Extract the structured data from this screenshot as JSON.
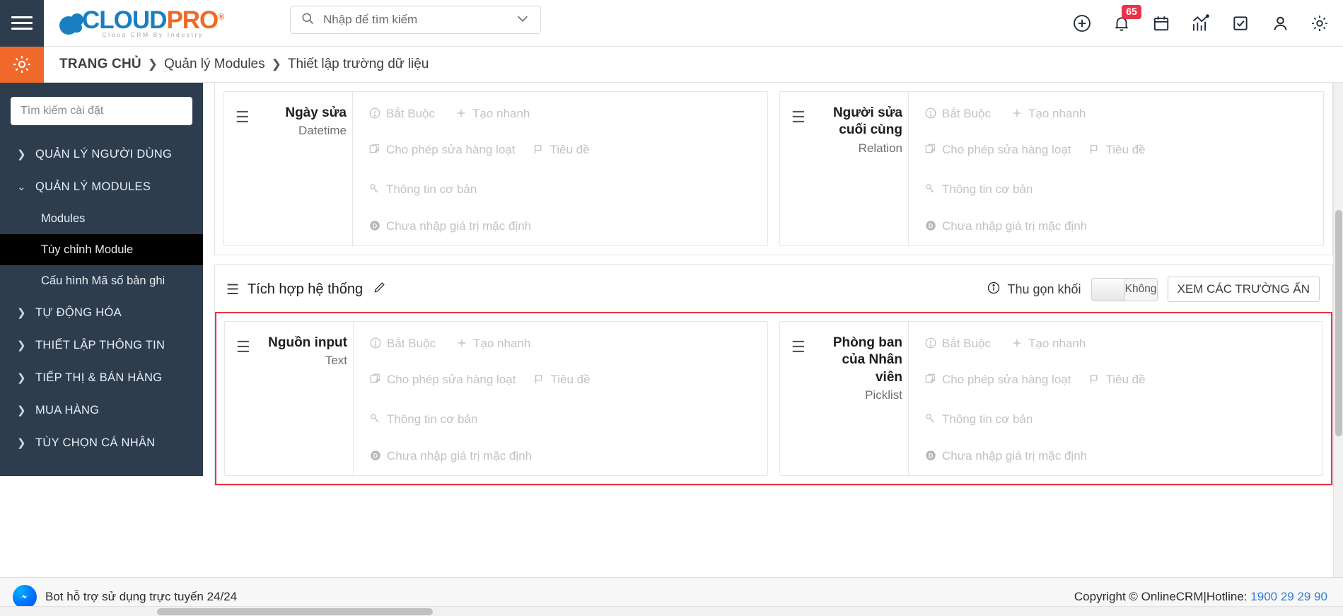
{
  "header": {
    "menu_icon": "hamburger-icon",
    "logo": {
      "cloud": "CLOUD",
      "pro": "PRO",
      "reg": "®",
      "tagline": "Cloud CRM By Industry"
    },
    "search": {
      "placeholder": "Nhập để tìm kiếm",
      "value": "",
      "icon": "search-icon",
      "chevron": "chevron-down-icon"
    },
    "icons": [
      {
        "name": "add-circle-icon",
        "label": ""
      },
      {
        "name": "bell-icon",
        "label": "",
        "badge": "65"
      },
      {
        "name": "calendar-icon",
        "label": ""
      },
      {
        "name": "analytics-icon",
        "label": ""
      },
      {
        "name": "task-check-icon",
        "label": ""
      },
      {
        "name": "user-icon",
        "label": ""
      },
      {
        "name": "settings-gear-icon",
        "label": ""
      }
    ]
  },
  "breadcrumb": {
    "gear_icon": "settings-gear-icon",
    "home": "TRANG CHỦ",
    "sep": "❯",
    "items": [
      "Quản lý Modules",
      "Thiết lập trường dữ liệu"
    ]
  },
  "sidebar": {
    "search_placeholder": "Tìm kiếm cài đặt",
    "items": [
      {
        "label": "QUẢN LÝ NGƯỜI DÙNG",
        "type": "group",
        "expanded": false,
        "arrow": "❯"
      },
      {
        "label": "QUẢN LÝ MODULES",
        "type": "group",
        "expanded": true,
        "arrow": "⌄"
      },
      {
        "label": "Modules",
        "type": "child",
        "active": false
      },
      {
        "label": "Tùy chỉnh Module",
        "type": "child",
        "active": true
      },
      {
        "label": "Cấu hình Mã số bản ghi",
        "type": "child",
        "active": false
      },
      {
        "label": "TỰ ĐỘNG HÓA",
        "type": "group",
        "expanded": false,
        "arrow": "❯"
      },
      {
        "label": "THIẾT LẬP THÔNG TIN",
        "type": "group",
        "expanded": false,
        "arrow": "❯"
      },
      {
        "label": "TIẾP THỊ & BÁN HÀNG",
        "type": "group",
        "expanded": false,
        "arrow": "❯"
      },
      {
        "label": "MUA HÀNG",
        "type": "group",
        "expanded": false,
        "arrow": "❯"
      },
      {
        "label": "TÙY CHỌN CÁ NHÂN",
        "type": "group",
        "expanded": false,
        "arrow": "❯"
      }
    ]
  },
  "field_props": {
    "required": "Bắt Buộc",
    "quick_create": "Tạo nhanh",
    "mass_edit": "Cho phép sửa hàng loạt",
    "title": "Tiêu đề",
    "basic_info": "Thông tin cơ bản",
    "no_default": "Chưa nhập giá trị mặc định"
  },
  "blocks": [
    {
      "id": "block-top",
      "highlighted": false,
      "fields": [
        {
          "name": "Ngày sửa",
          "type": "Datetime",
          "show_title_badge": true
        },
        {
          "name": "Người sửa cuối cùng",
          "type": "Relation",
          "show_title_badge": true
        }
      ]
    },
    {
      "id": "block-tich-hop",
      "highlighted": true,
      "title": "Tích hợp hệ thống",
      "edit_icon": "pencil-icon",
      "drag_icon": "drag-handle-icon",
      "collapse_label": "Thu gọn khối",
      "collapse_info_icon": "info-circle-icon",
      "toggle_value": "Không",
      "hidden_fields_button": "XEM CÁC TRƯỜNG ẨN",
      "fields": [
        {
          "name": "Nguồn input",
          "type": "Text",
          "show_title_badge": true
        },
        {
          "name": "Phòng ban của Nhân viên",
          "type": "Picklist",
          "show_title_badge": true
        }
      ]
    }
  ],
  "footer": {
    "chatbot_label": "Bot hỗ trợ sử dụng trực tuyến 24/24",
    "chatbot_icon": "messenger-icon",
    "copyright": "Copyright © OnlineCRM|Hotline:",
    "hotline": "1900 29 29 90"
  },
  "colors": {
    "sidebar_bg": "#2e3d4e",
    "accent_orange": "#f0682a",
    "brand_blue": "#1a7fc1",
    "badge_red": "#e8344a",
    "highlight_border": "#e8344a",
    "link_blue": "#2f7ed8"
  }
}
